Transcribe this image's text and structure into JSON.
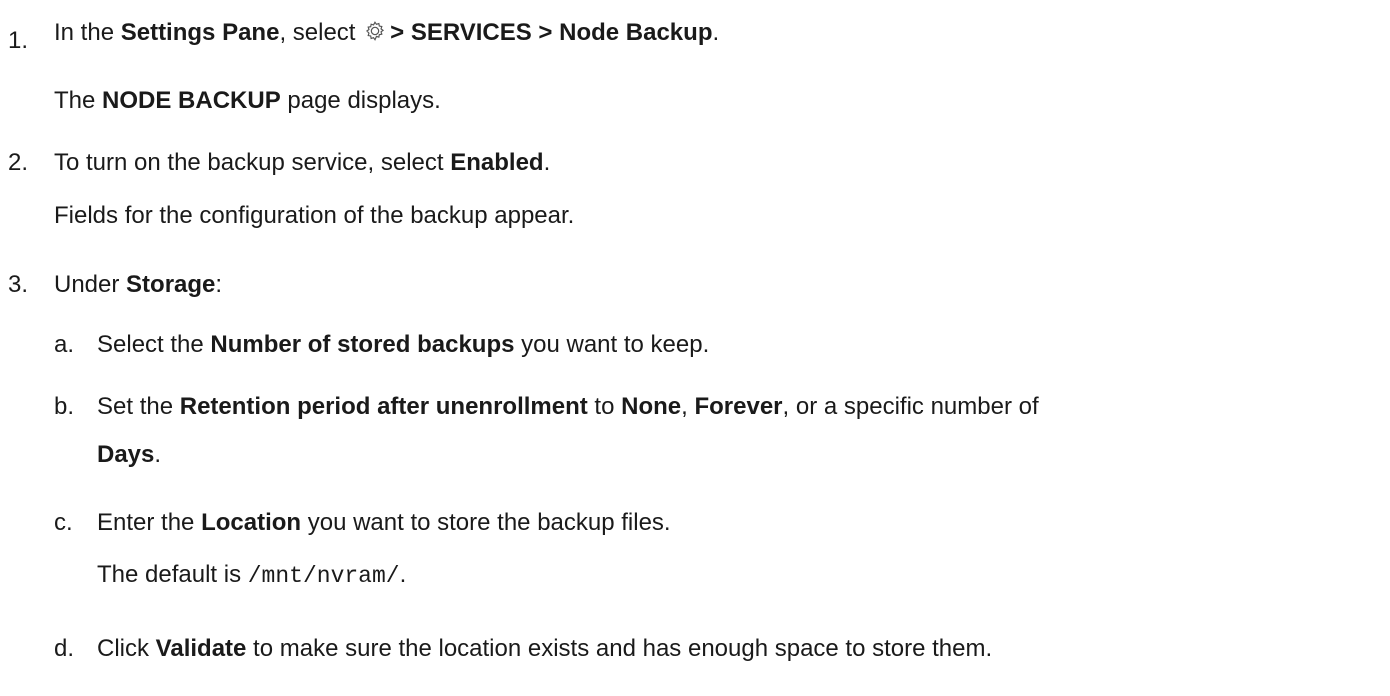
{
  "steps": [
    {
      "number": "1.",
      "text": {
        "prefix": "In the ",
        "settings_pane": "Settings Pane",
        "select": ", select ",
        "path": "> SERVICES > Node Backup",
        "period": "."
      },
      "result": {
        "the": "The ",
        "page_name": "NODE BACKUP",
        "rest": " page displays."
      }
    },
    {
      "number": "2.",
      "text": {
        "prefix": "To turn on the backup service, select ",
        "enabled": "Enabled",
        "period": "."
      },
      "result": "Fields for the configuration of the backup appear."
    },
    {
      "number": "3.",
      "text": {
        "prefix": "Under ",
        "storage": "Storage",
        "suffix": ":"
      },
      "substeps": [
        {
          "letter": "a.",
          "p1": "Select the ",
          "b1": "Number of stored backups",
          "p2": " you want to keep."
        },
        {
          "letter": "b.",
          "p1": "Set the ",
          "b1": "Retention period after unenrollment",
          "p2": " to ",
          "b2": "None",
          "p3": ", ",
          "b3": "Forever",
          "p4": ", or a specific number of",
          "b4": "Days",
          "p5": "."
        },
        {
          "letter": "c.",
          "p1": "Enter the ",
          "b1": "Location",
          "p2": " you want to store the backup files.",
          "default_prefix": "The default is ",
          "default_path": "/mnt/nvram/",
          "default_suffix": "."
        },
        {
          "letter": "d.",
          "p1": "Click ",
          "b1": "Validate",
          "p2": " to make sure the location exists and has enough space to store them."
        }
      ]
    }
  ],
  "icons": {
    "settings": "gear-icon"
  }
}
